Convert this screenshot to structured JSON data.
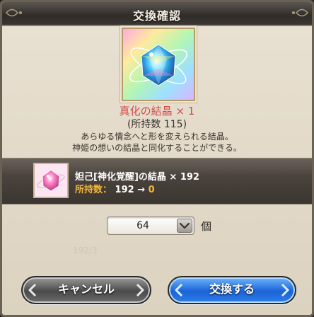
{
  "dialog": {
    "title": "交換確認"
  },
  "item": {
    "name": "真化の結晶 × 1",
    "owned": "(所持数 115)",
    "description_line1": "あらゆる情念へと形を変えられる結晶。",
    "description_line2": "神姫の想いの結晶と同化することができる。"
  },
  "cost": {
    "name": "妲己[神化覚醒]の結晶 × 192",
    "owned_label": "所持数：",
    "owned_before": "192",
    "arrow": "→",
    "owned_after": "0"
  },
  "quantity": {
    "value": "64",
    "unit": "個"
  },
  "background_text": "192/3",
  "buttons": {
    "cancel": "キャンセル",
    "exchange": "交換する"
  },
  "colors": {
    "accent_red": "#d44a4a",
    "accent_orange": "#f5b63b",
    "exchange_blue": "#1a63d6"
  },
  "icons": {
    "item": "rainbow-crystal-icon",
    "cost": "pink-crystal-icon",
    "dropdown": "chevron-down-icon"
  }
}
